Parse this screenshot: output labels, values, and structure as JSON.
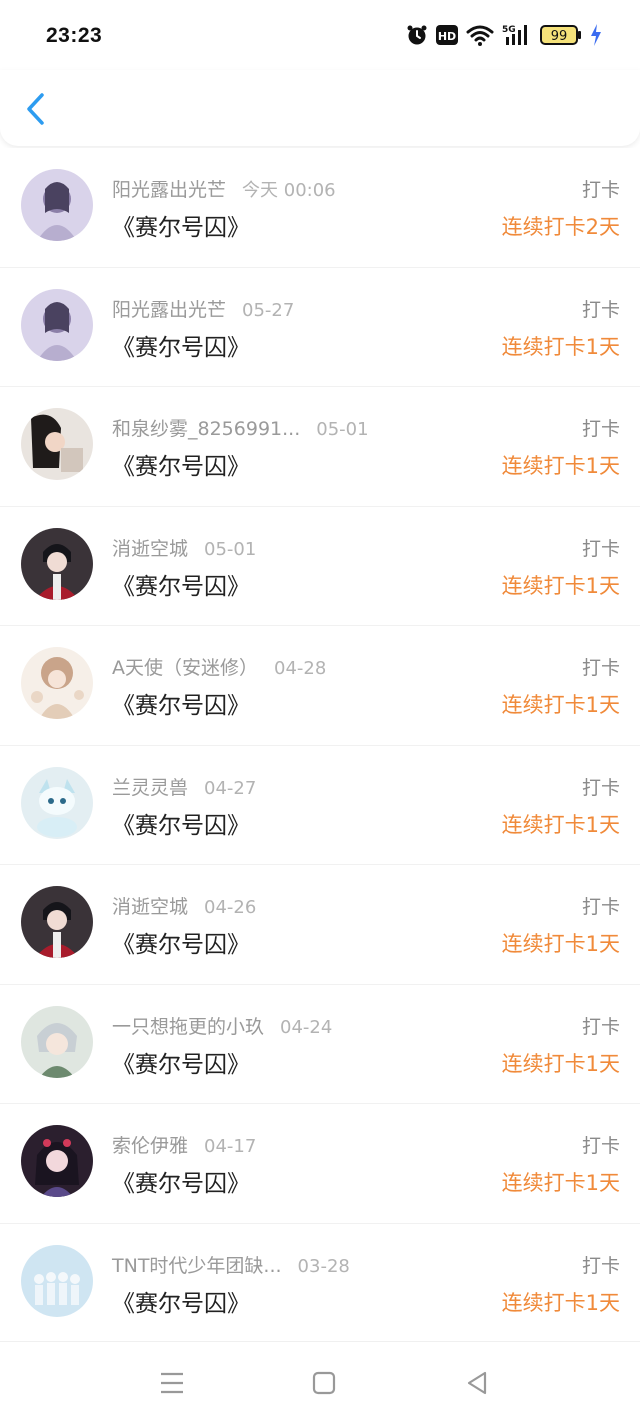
{
  "status_bar": {
    "time": "23:23",
    "battery": "99",
    "icons": [
      "alarm-icon",
      "hd-icon",
      "wifi-icon",
      "signal-5g-icon",
      "battery-icon",
      "charging-bolt-icon"
    ]
  },
  "header": {
    "back_icon": "chevron-left-icon"
  },
  "colors": {
    "accent_orange": "#f08a3a",
    "back_blue": "#2d9cf0"
  },
  "entries": [
    {
      "name": "阳光露出光芒",
      "date": "今天 00:06",
      "title": "《赛尔号囚》",
      "action": "打卡",
      "streak": "连续打卡2天"
    },
    {
      "name": "阳光露出光芒",
      "date": "05-27",
      "title": "《赛尔号囚》",
      "action": "打卡",
      "streak": "连续打卡1天"
    },
    {
      "name": "和泉纱雾_8256991...",
      "date": "05-01",
      "title": "《赛尔号囚》",
      "action": "打卡",
      "streak": "连续打卡1天"
    },
    {
      "name": "消逝空城",
      "date": "05-01",
      "title": "《赛尔号囚》",
      "action": "打卡",
      "streak": "连续打卡1天"
    },
    {
      "name": "A天使（安迷修）",
      "date": "04-28",
      "title": "《赛尔号囚》",
      "action": "打卡",
      "streak": "连续打卡1天"
    },
    {
      "name": "兰灵灵兽",
      "date": "04-27",
      "title": "《赛尔号囚》",
      "action": "打卡",
      "streak": "连续打卡1天"
    },
    {
      "name": "消逝空城",
      "date": "04-26",
      "title": "《赛尔号囚》",
      "action": "打卡",
      "streak": "连续打卡1天"
    },
    {
      "name": "一只想拖更的小玖",
      "date": "04-24",
      "title": "《赛尔号囚》",
      "action": "打卡",
      "streak": "连续打卡1天"
    },
    {
      "name": "索伦伊雅",
      "date": "04-17",
      "title": "《赛尔号囚》",
      "action": "打卡",
      "streak": "连续打卡1天"
    },
    {
      "name": "TNT时代少年团缺...",
      "date": "03-28",
      "title": "《赛尔号囚》",
      "action": "打卡",
      "streak": "连续打卡1天"
    }
  ],
  "nav_bar": {
    "icons": [
      "menu-icon",
      "home-square-icon",
      "back-triangle-icon"
    ]
  }
}
